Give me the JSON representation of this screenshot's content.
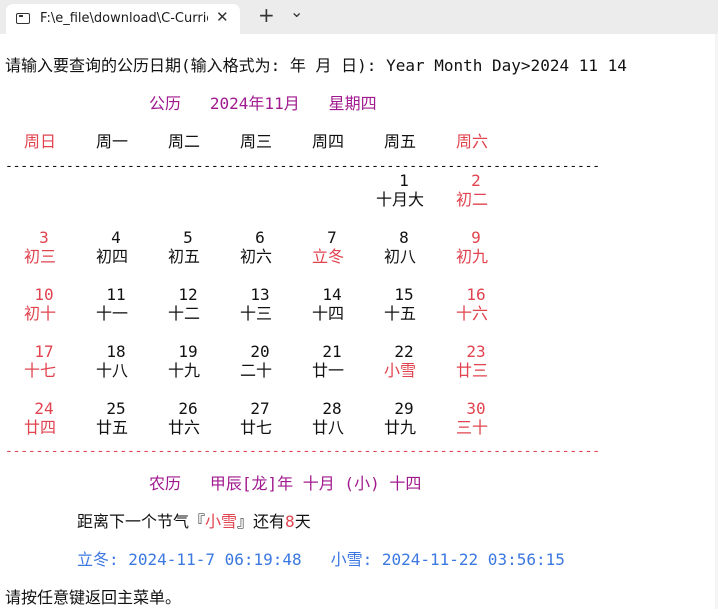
{
  "window": {
    "tab_title": "F:\\e_file\\download\\C-Curric",
    "close_glyph": "✕",
    "new_tab_glyph": "+",
    "dropdown_glyph": "⌄"
  },
  "prompt": "请输入要查询的公历日期(输入格式为: 年 月 日): Year Month Day>2024 11 14",
  "calendar_title": "公历   2024年11月   星期四",
  "weekdays": [
    "周日",
    "周一",
    "周二",
    "周三",
    "周四",
    "周五",
    "周六"
  ],
  "rule_line": "------------------------------------------------------------------------------",
  "weeks": [
    [
      null,
      null,
      null,
      null,
      null,
      {
        "day": "1",
        "lunar": "十月大"
      },
      {
        "day": "2",
        "lunar": "初二"
      }
    ],
    [
      {
        "day": "3",
        "lunar": "初三"
      },
      {
        "day": "4",
        "lunar": "初四"
      },
      {
        "day": "5",
        "lunar": "初五"
      },
      {
        "day": "6",
        "lunar": "初六"
      },
      {
        "day": "7",
        "lunar": "立冬"
      },
      {
        "day": "8",
        "lunar": "初八"
      },
      {
        "day": "9",
        "lunar": "初九"
      }
    ],
    [
      {
        "day": "10",
        "lunar": "初十"
      },
      {
        "day": "11",
        "lunar": "十一"
      },
      {
        "day": "12",
        "lunar": "十二"
      },
      {
        "day": "13",
        "lunar": "十三"
      },
      {
        "day": "14",
        "lunar": "十四"
      },
      {
        "day": "15",
        "lunar": "十五"
      },
      {
        "day": "16",
        "lunar": "十六"
      }
    ],
    [
      {
        "day": "17",
        "lunar": "十七"
      },
      {
        "day": "18",
        "lunar": "十八"
      },
      {
        "day": "19",
        "lunar": "十九"
      },
      {
        "day": "20",
        "lunar": "二十"
      },
      {
        "day": "21",
        "lunar": "廿一"
      },
      {
        "day": "22",
        "lunar": "小雪"
      },
      {
        "day": "23",
        "lunar": "廿三"
      }
    ],
    [
      {
        "day": "24",
        "lunar": "廿四"
      },
      {
        "day": "25",
        "lunar": "廿五"
      },
      {
        "day": "26",
        "lunar": "廿六"
      },
      {
        "day": "27",
        "lunar": "廿七"
      },
      {
        "day": "28",
        "lunar": "廿八"
      },
      {
        "day": "29",
        "lunar": "廿九"
      },
      {
        "day": "30",
        "lunar": "三十"
      }
    ]
  ],
  "lunar_title": "农历   甲辰[龙]年 十月 (小) 十四",
  "next_term": {
    "prefix": "距离下一个节气『",
    "name": "小雪",
    "middle": "』还有",
    "days": "8",
    "suffix": "天"
  },
  "terms_line": {
    "term1": "立冬: 2024-11-7 06:19:48",
    "term2": "小雪: 2024-11-22 03:56:15"
  },
  "footer": "请按任意键返回主菜单。",
  "colors": {
    "magenta": "#a0198f",
    "red": "#e1434f",
    "blue": "#3b78e0",
    "text": "#111111"
  }
}
